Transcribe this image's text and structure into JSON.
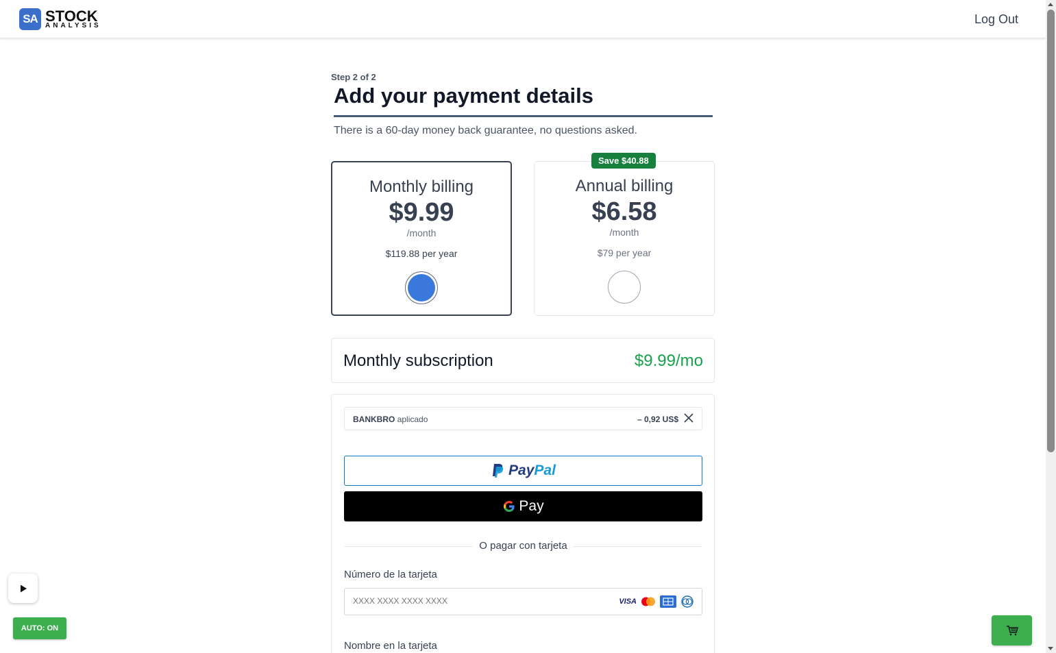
{
  "header": {
    "logo_badge": "SA",
    "logo_main": "STOCK",
    "logo_sub": "ANALYSIS",
    "logout_label": "Log Out"
  },
  "page": {
    "step": "Step 2 of 2",
    "title": "Add your payment details",
    "subtitle": "There is a 60-day money back guarantee, no questions asked."
  },
  "plans": {
    "monthly": {
      "name": "Monthly billing",
      "price": "$9.99",
      "per": "/month",
      "yearly": "$119.88 per year",
      "selected": true
    },
    "annual": {
      "badge": "Save $40.88",
      "name": "Annual billing",
      "price": "$6.58",
      "per": "/month",
      "yearly": "$79 per year",
      "selected": false
    }
  },
  "subscription": {
    "label": "Monthly subscription",
    "price": "$9.99/mo"
  },
  "payment": {
    "coupon_code": "BANKBRO",
    "coupon_status": "aplicado",
    "coupon_amount": "– 0,92 US$",
    "gpay_label": "Pay",
    "divider_text": "O pagar con tarjeta",
    "card_number_label": "Número de la tarjeta",
    "card_number_placeholder": "XXXX XXXX XXXX XXXX",
    "card_name_label": "Nombre en la tarjeta",
    "visa_text": "VISA"
  },
  "floating": {
    "auto_label": "AUTO: ON"
  },
  "colors": {
    "accent_blue": "#3b78db",
    "green": "#16a34a",
    "badge_green": "#16803c",
    "button_green": "#3cae4d"
  }
}
